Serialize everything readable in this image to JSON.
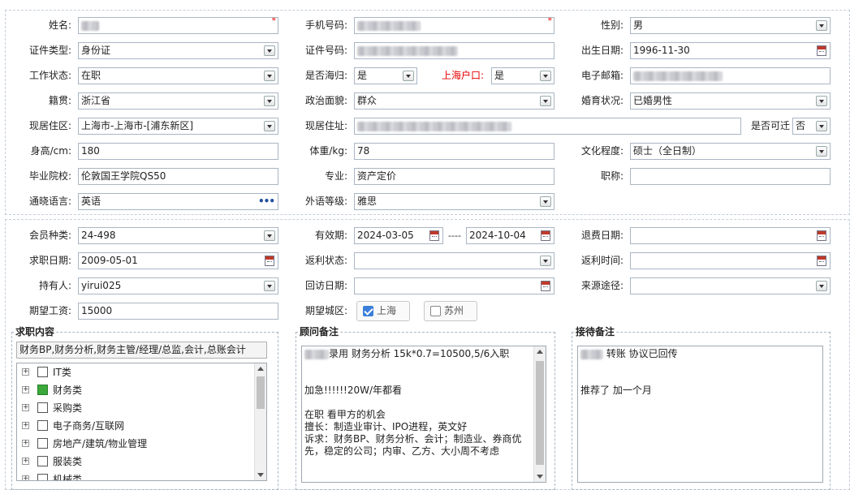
{
  "personal": {
    "name": {
      "label": "姓名:"
    },
    "phone": {
      "label": "手机号码:"
    },
    "gender": {
      "label": "性别:",
      "value": "男"
    },
    "id_type": {
      "label": "证件类型:",
      "value": "身份证"
    },
    "id_number": {
      "label": "证件号码:"
    },
    "birth_date": {
      "label": "出生日期:",
      "value": "1996-11-30"
    },
    "work_status": {
      "label": "工作状态:",
      "value": "在职"
    },
    "returnee": {
      "label": "是否海归:",
      "value": "是"
    },
    "shanghai_hukou": {
      "label": "上海户口:",
      "value": "是"
    },
    "email": {
      "label": "电子邮箱:"
    },
    "native_place": {
      "label": "籍贯:",
      "value": "浙江省"
    },
    "political_status": {
      "label": "政治面貌:",
      "value": "群众"
    },
    "marital_status": {
      "label": "婚育状况:",
      "value": "已婚男性"
    },
    "residence_area": {
      "label": "现居住区:",
      "value": "上海市-上海市-[浦东新区]"
    },
    "address": {
      "label": "现居住址:"
    },
    "relocate": {
      "label": "是否可迁",
      "value": "否"
    },
    "height": {
      "label": "身高/cm:",
      "value": "180"
    },
    "weight": {
      "label": "体重/kg:",
      "value": "78"
    },
    "education": {
      "label": "文化程度:",
      "value": "硕士（全日制）"
    },
    "school": {
      "label": "毕业院校:",
      "value": "伦敦国王学院QS50"
    },
    "major": {
      "label": "专业:",
      "value": "资产定价"
    },
    "title": {
      "label": "职称:",
      "value": ""
    },
    "language": {
      "label": "通晓语言:",
      "value": "英语"
    },
    "language_level": {
      "label": "外语等级:",
      "value": "雅思"
    }
  },
  "membership": {
    "member_type": {
      "label": "会员种类:",
      "value": "24-498"
    },
    "validity": {
      "label": "有效期:",
      "from": "2024-03-05",
      "sep": "----",
      "to": "2024-10-04"
    },
    "refund_date": {
      "label": "退费日期:",
      "value": ""
    },
    "job_date": {
      "label": "求职日期:",
      "value": "2009-05-01"
    },
    "rebate_status": {
      "label": "返利状态:",
      "value": ""
    },
    "rebate_time": {
      "label": "返利时间:",
      "value": ""
    },
    "holder": {
      "label": "持有人:",
      "value": "yirui025"
    },
    "visit_date": {
      "label": "回访日期:",
      "value": ""
    },
    "source": {
      "label": "来源途径:",
      "value": ""
    },
    "expected_salary": {
      "label": "期望工资:",
      "value": "15000"
    },
    "expected_city": {
      "label": "期望城区:",
      "options": [
        {
          "label": "上海",
          "checked": true
        },
        {
          "label": "苏州",
          "checked": false
        }
      ]
    }
  },
  "job_content": {
    "legend": "求职内容",
    "summary": "财务BP,财务分析,财务主管/经理/总监,会计,总账会计",
    "tree": [
      {
        "label": "IT类",
        "checked": false
      },
      {
        "label": "财务类",
        "checked": true
      },
      {
        "label": "采购类",
        "checked": false
      },
      {
        "label": "电子商务/互联网",
        "checked": false
      },
      {
        "label": "房地产/建筑/物业管理",
        "checked": false
      },
      {
        "label": "服装类",
        "checked": false
      },
      {
        "label": "机械类",
        "checked": false
      }
    ]
  },
  "consultant_notes": {
    "legend": "顾问备注",
    "lines": [
      "录用 财务分析 15k*0.7=10500,5/6入职",
      "",
      "",
      "加急!!!!!!20W/年都看",
      "",
      "在职 看甲方的机会",
      "擅长：制造业审计、IPO进程，英文好",
      "诉求：财务BP、财务分析、会计；制造业、券商优",
      "先，稳定的公司；内审、乙方、大小周不考虑"
    ]
  },
  "reception_notes": {
    "legend": "接待备注",
    "lines": [
      "转账 协议已回传",
      "",
      "",
      "推荐了 加一个月"
    ]
  },
  "colors": {
    "required_star": "#e60000",
    "hukou_label": "#e60000",
    "check_on": "#3b7fd9",
    "tree_check_on": "#3aa93a"
  }
}
